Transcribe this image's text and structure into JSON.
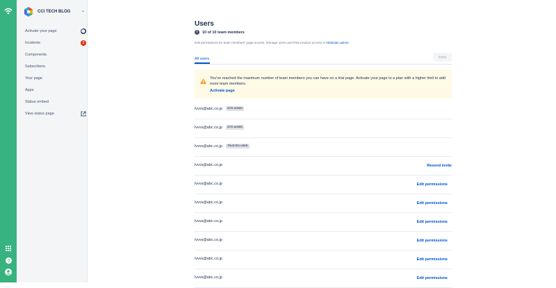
{
  "app": {
    "name": "CCI TECH BLOG"
  },
  "sidebar": {
    "items": [
      {
        "label": "Activate your page",
        "indicator": "progress"
      },
      {
        "label": "Incidents",
        "badge": "1"
      },
      {
        "label": "Components"
      },
      {
        "label": "Subscribers"
      },
      {
        "label": "Your page"
      },
      {
        "label": "Apps"
      },
      {
        "label": "Status embed"
      },
      {
        "label": "View status page",
        "indicator": "external-link"
      }
    ]
  },
  "main": {
    "title": "Users",
    "member_count": "10 of 10 team members",
    "description": "Edit permissions for team members' page access. Manage users and their product access in",
    "description_link": "Atlassian admin",
    "description_end": ".",
    "tab": "All users",
    "invite_label": "Invite",
    "warning": {
      "text": "You've reached the maximum number of team members you can have on a trial page. Activate your page to a plan with a higher limit to add more team members.",
      "link": "Activate page"
    },
    "users": [
      {
        "email": "lvvvs@abc.co.jp",
        "badge": "SITE ADMIN",
        "action": ""
      },
      {
        "email": "lvvvs@abc.co.jp",
        "badge": "SITE ADMIN",
        "action": ""
      },
      {
        "email": "lvvvs@abc.co.jp",
        "badge": "TRUSTED USER",
        "action": ""
      },
      {
        "email": "lvvvs@abc.co.jp",
        "badge": "",
        "action": "Resend invite"
      },
      {
        "email": "lvvvs@abc.co.jp",
        "badge": "",
        "action": "Edit permissions"
      },
      {
        "email": "lvvvs@abc.co.jp",
        "badge": "",
        "action": "Edit permissions"
      },
      {
        "email": "lvvvs@abc.co.jp",
        "badge": "",
        "action": "Edit permissions"
      },
      {
        "email": "lvvvs@abc.co.jp",
        "badge": "",
        "action": "Edit permissions"
      },
      {
        "email": "lvvvs@abc.co.jp",
        "badge": "",
        "action": "Edit permissions"
      },
      {
        "email": "lvvvs@abc.co.jp",
        "badge": "",
        "action": "Edit permissions"
      }
    ]
  },
  "colors": {
    "rail": "#36b37e",
    "link": "#0052cc",
    "warning_bg": "#fffae6",
    "badge_red": "#de350b"
  }
}
